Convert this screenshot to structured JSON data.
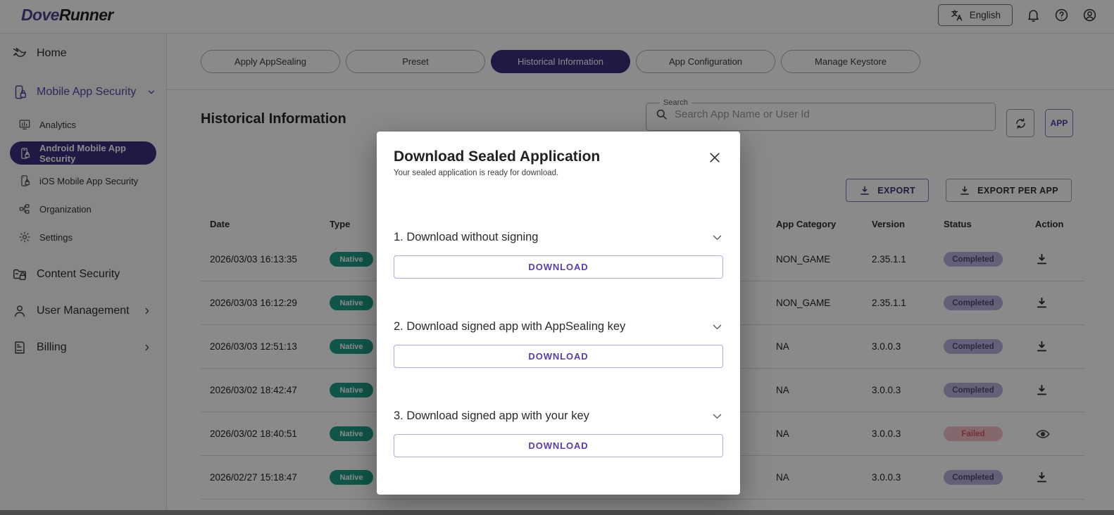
{
  "topbar": {
    "logo": {
      "part1": "Dove",
      "part2": "Runner"
    },
    "language": "English"
  },
  "sidebar": {
    "home": "Home",
    "mobile_app_security": "Mobile App Security",
    "analytics": "Analytics",
    "android": "Android Mobile App Security",
    "ios": "iOS Mobile App Security",
    "organization": "Organization",
    "settings": "Settings",
    "content_security": "Content Security",
    "user_management": "User Management",
    "billing": "Billing"
  },
  "tabs": {
    "apply": "Apply AppSealing",
    "preset": "Preset",
    "historical": "Historical Information",
    "app_config": "App Configuration",
    "manage_keystore": "Manage Keystore",
    "active": "Historical Information"
  },
  "page": {
    "title": "Historical Information"
  },
  "search": {
    "legend": "Search",
    "placeholder": "Search App Name or User Id",
    "app_button": "APP"
  },
  "toolbar": {
    "export": "EXPORT",
    "export_per_app": "EXPORT PER APP"
  },
  "table": {
    "headers": {
      "date": "Date",
      "type": "Type",
      "category": "App Category",
      "version": "Version",
      "status": "Status",
      "action": "Action"
    },
    "rows": [
      {
        "date": "2026/03/03 16:13:35",
        "type": "Native",
        "category": "NON_GAME",
        "version": "2.35.1.1",
        "status": "Completed"
      },
      {
        "date": "2026/03/03 16:12:29",
        "type": "Native",
        "category": "NON_GAME",
        "version": "2.35.1.1",
        "status": "Completed"
      },
      {
        "date": "2026/03/03 12:51:13",
        "type": "Native",
        "category": "NA",
        "version": "3.0.0.3",
        "status": "Completed"
      },
      {
        "date": "2026/03/02 18:42:47",
        "type": "Native",
        "category": "NA",
        "version": "3.0.0.3",
        "status": "Completed"
      },
      {
        "date": "2026/03/02 18:40:51",
        "type": "Native",
        "category": "NA",
        "version": "3.0.0.3",
        "status": "Failed"
      },
      {
        "date": "2026/02/27 15:18:47",
        "type": "Native",
        "category": "NA",
        "version": "3.0.0.3",
        "status": "Completed"
      }
    ]
  },
  "modal": {
    "title": "Download Sealed Application",
    "subtitle": "Your sealed application is ready for download.",
    "sections": [
      {
        "label": "1. Download without signing",
        "button": "DOWNLOAD"
      },
      {
        "label": "2. Download signed app with AppSealing key",
        "button": "DOWNLOAD"
      },
      {
        "label": "3. Download signed app with your key",
        "button": "DOWNLOAD"
      }
    ]
  },
  "colors": {
    "brand_purple": "#3F2E7E",
    "accent_purple": "#5B3CAB",
    "badge_native": "#1F9E89",
    "status_completed_bg": "#B7B2DC",
    "status_completed_text": "#504C73",
    "status_failed_bg": "#F2C3C8",
    "status_failed_text": "#E6525F"
  }
}
